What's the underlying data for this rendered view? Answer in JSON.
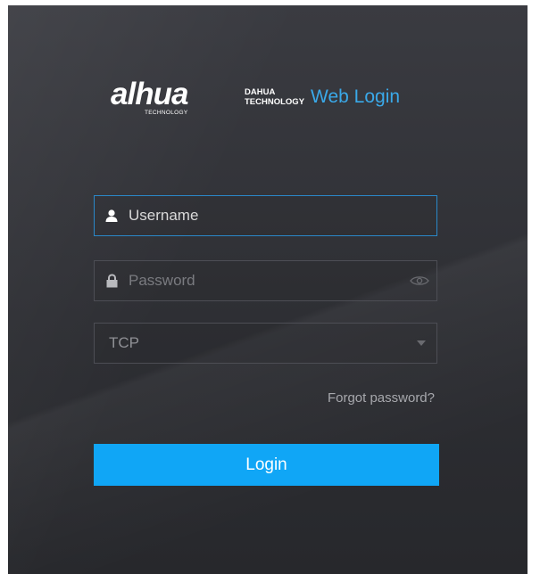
{
  "logo": {
    "brand": "alhua",
    "brand_sub": "TECHNOLOGY",
    "company_line1": "DAHUA",
    "company_line2": "TECHNOLOGY",
    "title": "Web Login"
  },
  "username": {
    "value": "",
    "placeholder": "Username",
    "icon": "user-icon"
  },
  "password": {
    "value": "",
    "placeholder": "Password",
    "icon": "lock-icon",
    "toggle_icon": "eye-icon"
  },
  "protocol": {
    "selected": "TCP",
    "icon": "chevron-down-icon"
  },
  "forgot_label": "Forgot password?",
  "login_label": "Login",
  "colors": {
    "accent": "#10a6f6",
    "title_blue": "#3aa9e9",
    "focus_border": "#2a88c9",
    "panel_bg": "#2e2f34"
  }
}
